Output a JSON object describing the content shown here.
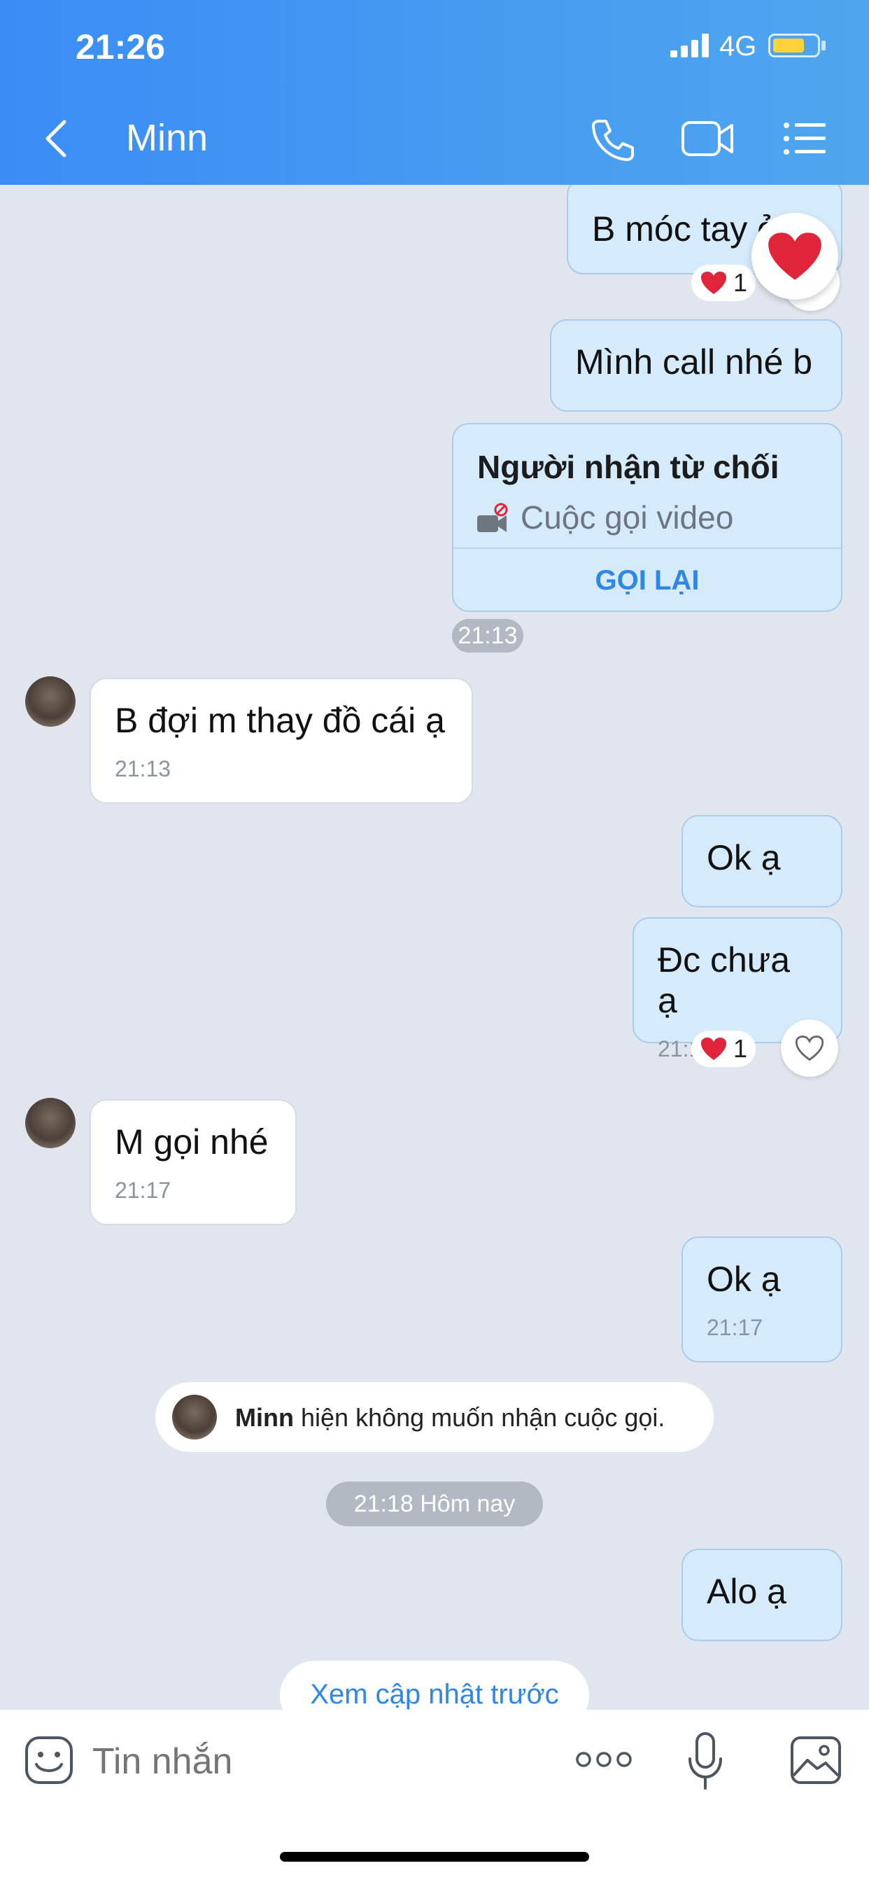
{
  "status_bar": {
    "time": "21:26",
    "network": "4G"
  },
  "header": {
    "contact_name": "Minn"
  },
  "messages": {
    "m1": {
      "text": "B móc tay ở",
      "reaction_count": "1"
    },
    "m2": {
      "text": "Mình call nhé b"
    },
    "call": {
      "title": "Người nhận từ chối",
      "subtitle": "Cuộc gọi video",
      "action": "GỌI LẠI",
      "time": "21:13"
    },
    "m3": {
      "text": "B đợi m thay đồ cái ạ",
      "time": "21:13"
    },
    "m4": {
      "text": "Ok ạ"
    },
    "m5": {
      "text": "Đc chưa ạ",
      "time": "21:15",
      "reaction_count": "1"
    },
    "m6": {
      "text": "M gọi nhé",
      "time": "21:17"
    },
    "m7": {
      "text": "Ok ạ",
      "time": "21:17"
    },
    "notice": {
      "name": "Minn",
      "text": "hiện không muốn nhận cuộc gọi."
    },
    "divider": "21:18 Hôm nay",
    "m8": {
      "text": "Alo ạ"
    },
    "load_more": "Xem cập nhật trước"
  },
  "input": {
    "placeholder": "Tin nhắn"
  },
  "colors": {
    "header_start": "#3a8df5",
    "header_end": "#4fa6ee",
    "outgoing_bubble": "#d5ebfc",
    "link": "#2e86e6",
    "heart": "#e0243a"
  },
  "icons": [
    "back-icon",
    "phone-icon",
    "video-call-icon",
    "menu-list-icon",
    "heart-icon",
    "sticker-icon",
    "more-icon",
    "microphone-icon",
    "image-icon"
  ]
}
